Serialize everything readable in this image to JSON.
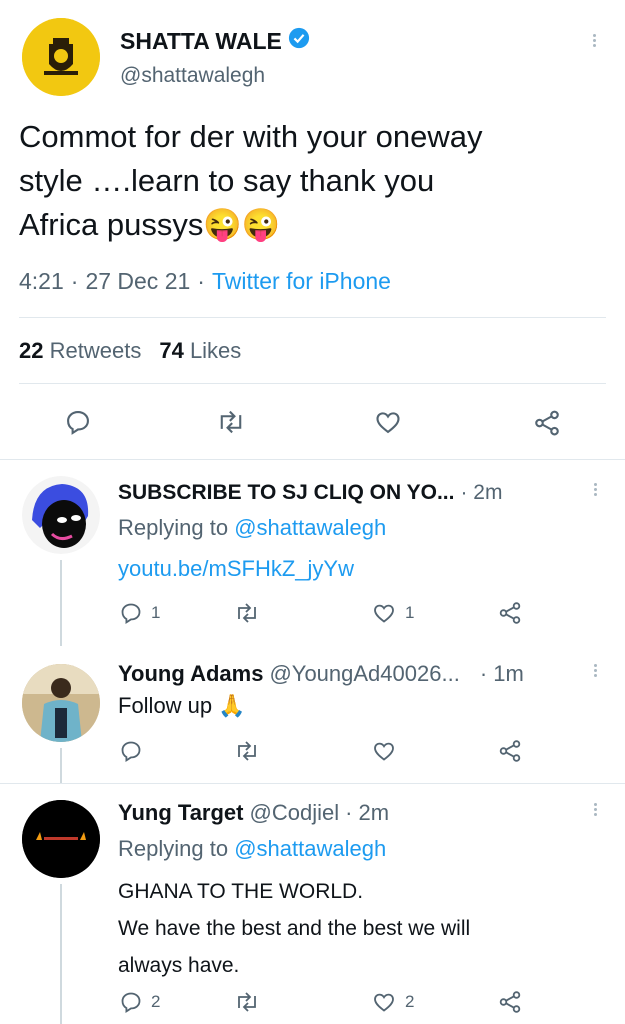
{
  "main_tweet": {
    "display_name": "SHATTA WALE",
    "handle": "@shattawalegh",
    "text_lines": [
      "Commot for der with your oneway",
      "style ….learn  to say thank you",
      "Africa pussys😜😜"
    ],
    "time": "4:21",
    "dot1": "·",
    "date": "27 Dec 21",
    "dot2": "·",
    "source": "Twitter for iPhone",
    "retweets_count": "22",
    "retweets_label": "Retweets",
    "likes_count": "74",
    "likes_label": "Likes"
  },
  "replies": [
    {
      "display_name": "SUBSCRIBE TO SJ CLIQ ON YO...",
      "time": "· 2m",
      "replying_prefix": "Replying to",
      "replying_to": "@shattawalegh",
      "text": "youtu.be/mSFHkZ_jyYw",
      "reply_count": "1",
      "like_count": "1"
    },
    {
      "display_name": "Young Adams",
      "handle": "@YoungAd40026...",
      "time": "· 1m",
      "text": "Follow up 🙏"
    },
    {
      "display_name": "Yung Target",
      "handle": "@Codjiel",
      "time": "· 2m",
      "replying_prefix": "Replying to",
      "replying_to": "@shattawalegh",
      "text_lines": [
        "GHANA TO THE WORLD.",
        "We have the best and the best we will",
        "always have."
      ],
      "reply_count": "2",
      "like_count": "2"
    }
  ],
  "colors": {
    "link": "#1d9bf0",
    "secondary": "#536471",
    "verified": "#1d9bf0"
  }
}
